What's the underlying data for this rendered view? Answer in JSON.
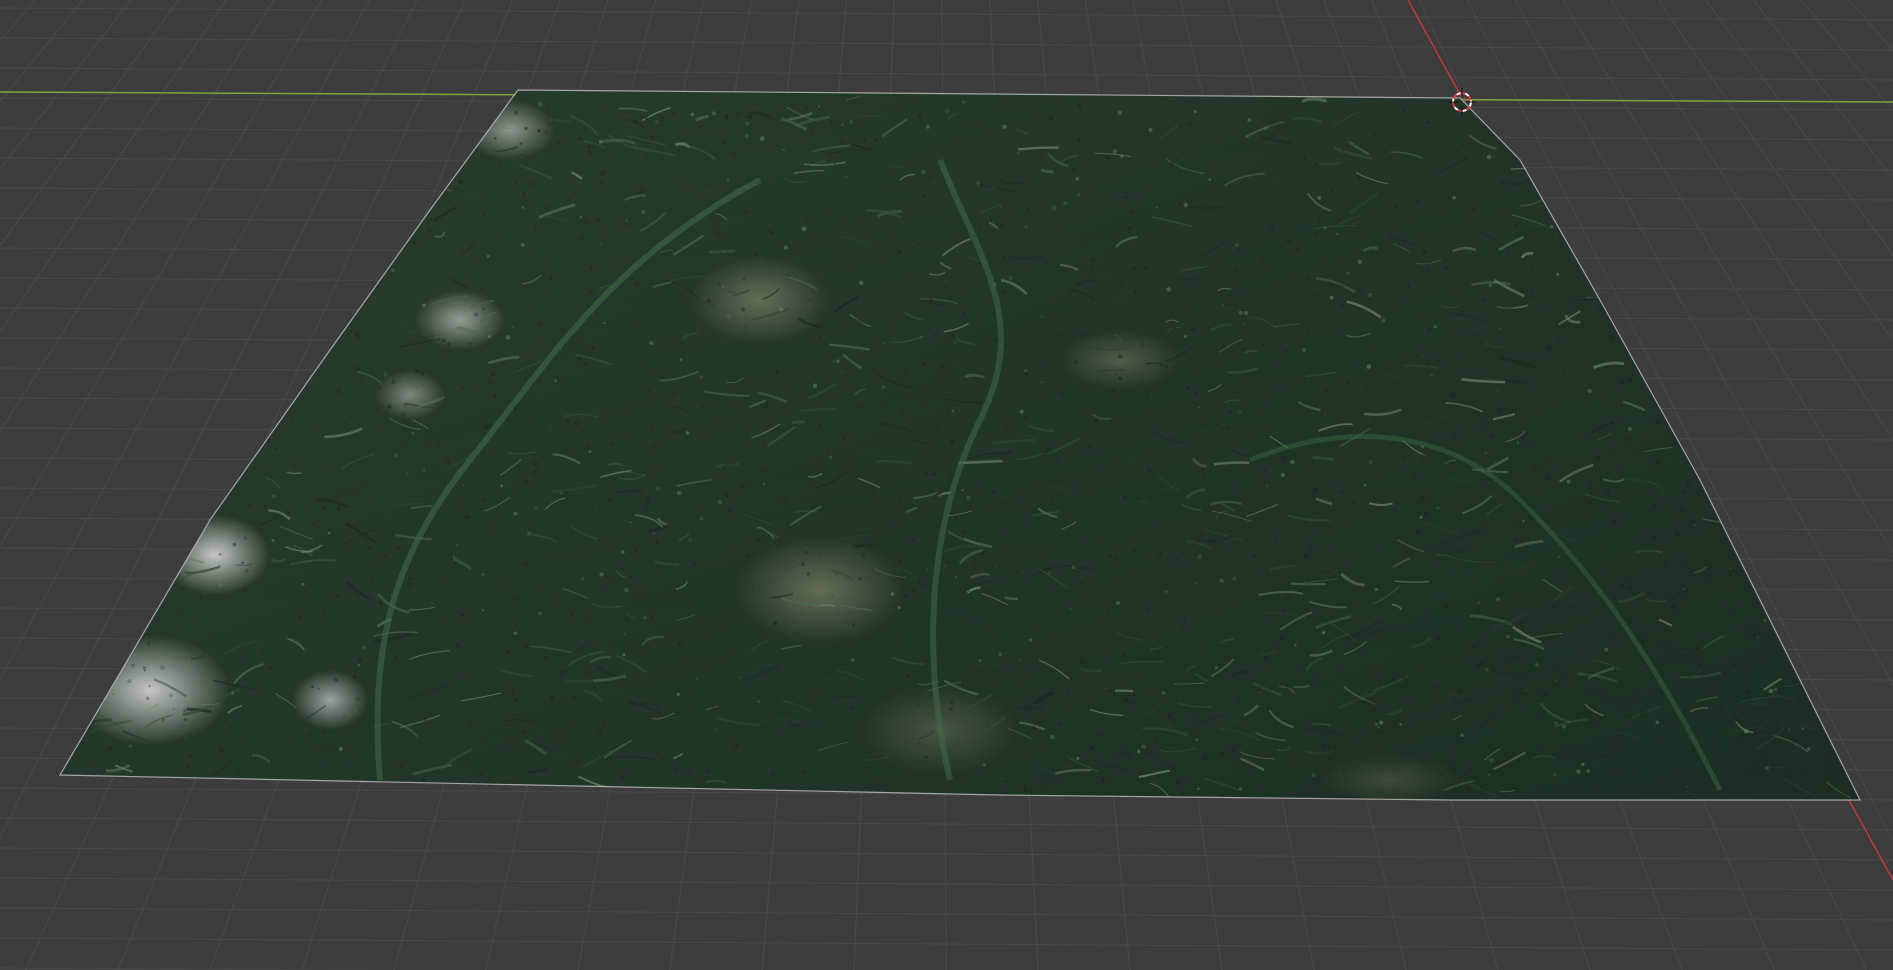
{
  "viewport": {
    "background_color": "#3d3d3d",
    "grid_line_color": "#4a4a4a",
    "x_axis_color": "#c0393b",
    "y_axis_color": "#7ea43a",
    "cursor_color_primary": "#ffffff",
    "cursor_color_secondary": "#e0393b"
  },
  "scene": {
    "object": "terrain-mesh",
    "texture": "satellite-forest-mountains",
    "terrain_color_dark": "#1f2f25",
    "terrain_color_mid": "#2f4a36",
    "terrain_color_light": "#4d6a4f",
    "rock_color": "#a7a9a3",
    "edge_color": "#c9c9c9"
  },
  "icons": {
    "cursor": "3d-cursor-icon"
  }
}
